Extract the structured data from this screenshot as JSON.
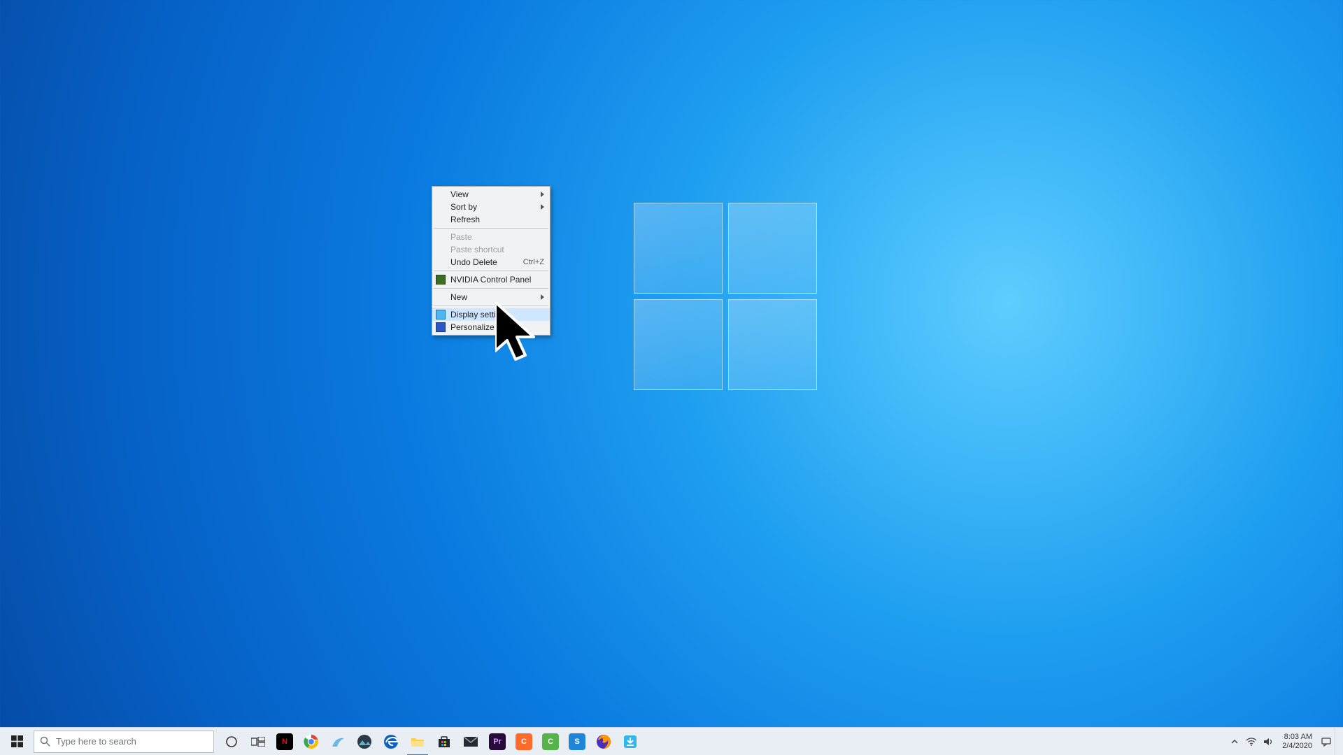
{
  "context_menu": {
    "items": [
      {
        "label": "View",
        "submenu": true,
        "disabled": false,
        "icon": "",
        "accel": ""
      },
      {
        "label": "Sort by",
        "submenu": true,
        "disabled": false,
        "icon": "",
        "accel": ""
      },
      {
        "label": "Refresh",
        "submenu": false,
        "disabled": false,
        "icon": "",
        "accel": ""
      },
      {
        "sep": true
      },
      {
        "label": "Paste",
        "submenu": false,
        "disabled": true,
        "icon": "",
        "accel": ""
      },
      {
        "label": "Paste shortcut",
        "submenu": false,
        "disabled": true,
        "icon": "",
        "accel": ""
      },
      {
        "label": "Undo Delete",
        "submenu": false,
        "disabled": false,
        "icon": "",
        "accel": "Ctrl+Z"
      },
      {
        "sep": true
      },
      {
        "label": "NVIDIA Control Panel",
        "submenu": false,
        "disabled": false,
        "icon": "nvidia",
        "accel": ""
      },
      {
        "sep": true
      },
      {
        "label": "New",
        "submenu": true,
        "disabled": false,
        "icon": "",
        "accel": ""
      },
      {
        "sep": true
      },
      {
        "label": "Display settings",
        "submenu": false,
        "disabled": false,
        "icon": "display",
        "accel": "",
        "hover": true
      },
      {
        "label": "Personalize",
        "submenu": false,
        "disabled": false,
        "icon": "personalize",
        "accel": ""
      }
    ]
  },
  "search": {
    "placeholder": "Type here to search"
  },
  "taskbar": {
    "apps": [
      {
        "name": "cortana",
        "running": false
      },
      {
        "name": "task-view",
        "running": false
      },
      {
        "name": "netflix",
        "running": false
      },
      {
        "name": "chrome",
        "running": false
      },
      {
        "name": "app-blue-wing",
        "running": false
      },
      {
        "name": "photos",
        "running": false
      },
      {
        "name": "edge",
        "running": false
      },
      {
        "name": "file-explorer",
        "running": true
      },
      {
        "name": "microsoft-store",
        "running": false
      },
      {
        "name": "mail",
        "running": false
      },
      {
        "name": "premiere-pro",
        "running": false
      },
      {
        "name": "app-orange-c",
        "running": false
      },
      {
        "name": "camtasia",
        "running": false
      },
      {
        "name": "snagit",
        "running": false
      },
      {
        "name": "firefox",
        "running": false
      },
      {
        "name": "free-download-manager",
        "running": false
      }
    ]
  },
  "tray": {
    "time": "8:03 AM",
    "date": "2/4/2020"
  }
}
